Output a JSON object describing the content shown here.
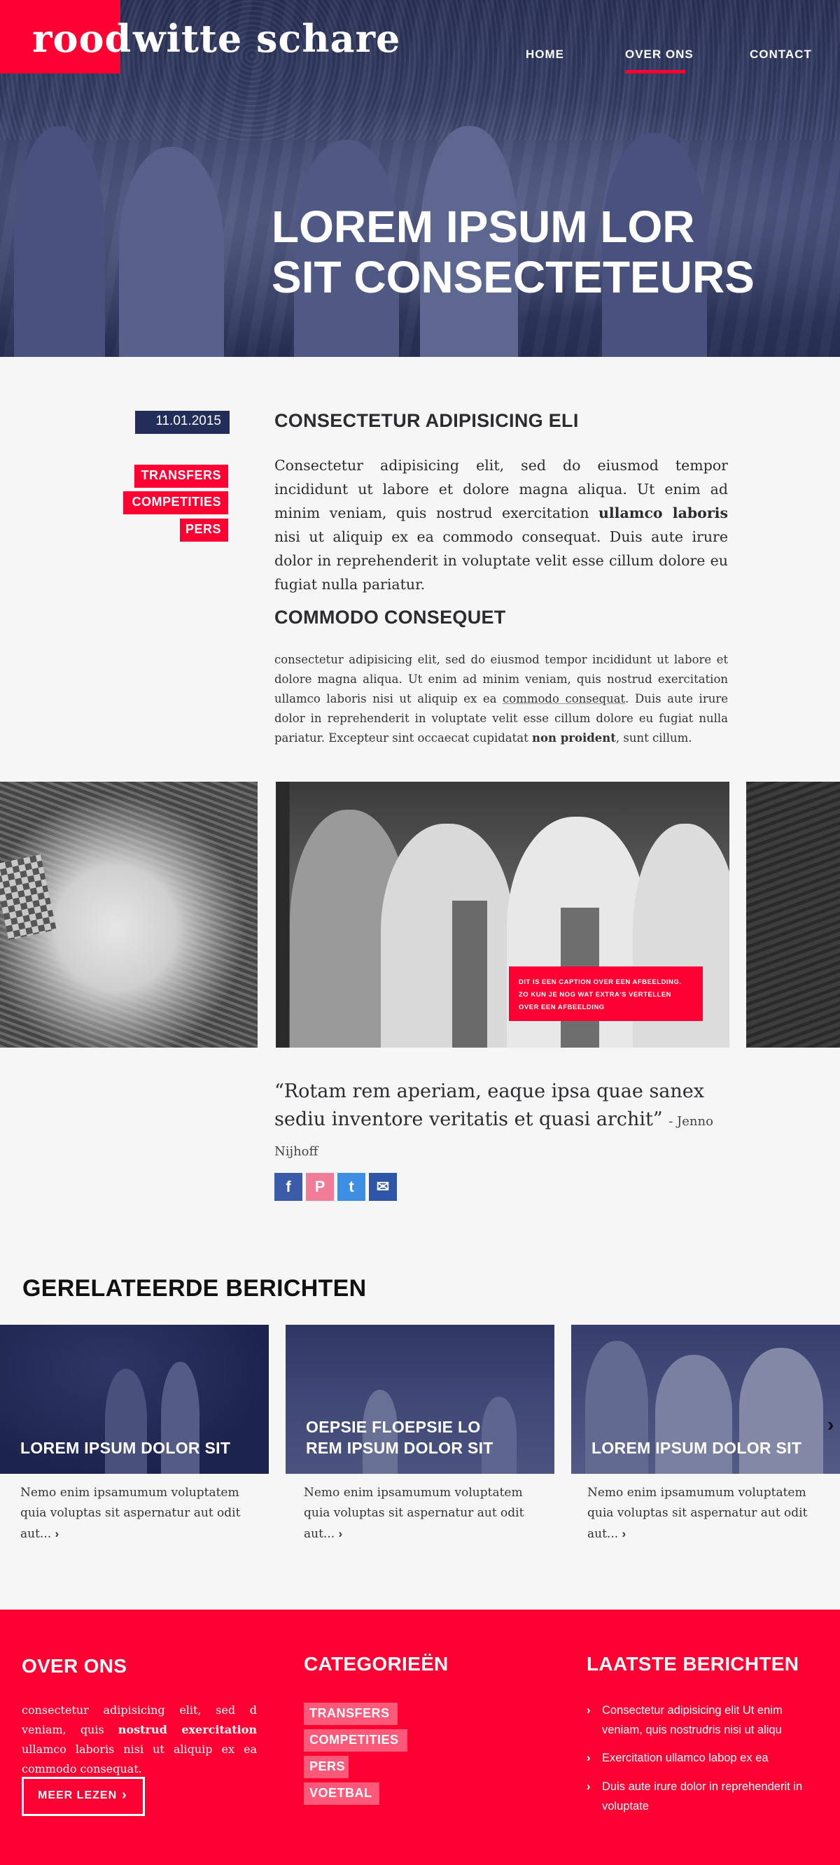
{
  "header": {
    "logo_word1": "rood",
    "logo_rest": "witte schare",
    "nav": [
      {
        "label": "HOME"
      },
      {
        "label": "OVER ONS",
        "active": true
      },
      {
        "label": "CONTACT"
      }
    ],
    "hero_title": "LOREM IPSUM LOR\nSIT CONSECTETEURS"
  },
  "article": {
    "date": "11.01.2015",
    "tags": [
      "TRANSFERS",
      "COMPETITIES",
      "PERS"
    ],
    "heading1": "CONSECTETUR ADIPISICING ELI",
    "lead_before_bold": "Consectetur adipisicing elit, sed do eiusmod tempor incididunt ut labore et dolore magna aliqua. Ut enim ad minim veniam, quis nostrud exercitation ",
    "lead_bold": "ullamco laboris",
    "lead_after_bold": " nisi ut aliquip ex ea commodo consequat. Duis aute irure dolor in reprehenderit in voluptate velit esse cillum dolore eu fugiat nulla pariatur.",
    "heading2": "COMMODO CONSEQUET",
    "body_before_link": "consectetur adipisicing elit, sed do eiusmod tempor incididunt ut labore et dolore magna aliqua. Ut enim ad minim veniam, quis nostrud exercitation ullamco laboris nisi ut aliquip ex ea ",
    "body_link": "commodo consequat",
    "body_after_link": ". Duis aute irure dolor in reprehenderit in voluptate velit esse cillum dolore eu fugiat nulla pariatur. Excepteur sint occaecat cupidatat ",
    "body_bold": "non proident",
    "body_end": ", sunt cillum."
  },
  "gallery": {
    "caption": "DIT IS EEN CAPTION OVER EEN AFBEELDING. ZO KUN JE NOG WAT EXTRA'S VERTELLEN OVER EEN AFBEELDING"
  },
  "quote": {
    "text": "“Rotam rem aperiam, eaque ipsa quae sanex sediu inventore veritatis et quasi archit”",
    "author": "- Jenno Nijhoff"
  },
  "share": [
    {
      "icon": "facebook-icon",
      "glyph": "f",
      "color": "#3b5ca8"
    },
    {
      "icon": "pinterest-icon",
      "glyph": "P",
      "color": "#f07c98"
    },
    {
      "icon": "twitter-icon",
      "glyph": "t",
      "color": "#3d8fe3"
    },
    {
      "icon": "mail-icon",
      "glyph": "✉",
      "color": "#2e55a8"
    }
  ],
  "related": {
    "title": "GERELATEERDE BERICHTEN",
    "cards": [
      {
        "title": "LOREM IPSUM DOLOR SIT",
        "text": "Nemo enim ipsamumum voluptatem quia voluptas sit aspernatur aut odit aut..."
      },
      {
        "title": "OEPSIE FLOEPSIE LO\nREM IPSUM DOLOR SIT",
        "text": "Nemo enim ipsamumum voluptatem quia voluptas sit aspernatur aut odit aut..."
      },
      {
        "title": "LOREM IPSUM DOLOR SIT",
        "text": "Nemo enim ipsamumum voluptatem quia voluptas sit aspernatur aut odit aut..."
      }
    ]
  },
  "footer": {
    "about_title": "OVER ONS",
    "about_before_bold": "consectetur adipisicing elit, sed d veniam, quis ",
    "about_bold": "nostrud exercitation",
    "about_after_bold": " ullamco laboris nisi ut aliquip ex ea commodo consequat.",
    "more_label": "MEER LEZEN",
    "categories_title": "CATEGORIEËN",
    "categories": [
      "TRANSFERS",
      "COMPETITIES",
      "PERS",
      "VOETBAL"
    ],
    "latest_title": "LAATSTE BERICHTEN",
    "latest": [
      "Consectetur adipisicing elit Ut enim veniam, quis nostrudris nisi ut aliqu",
      "Exercitation ullamco labop ex ea",
      "Duis aute irure dolor in reprehenderit in voluptate"
    ]
  },
  "colors": {
    "accent": "#ff0033",
    "navy": "#232d5a",
    "background": "#f6f6f7"
  }
}
